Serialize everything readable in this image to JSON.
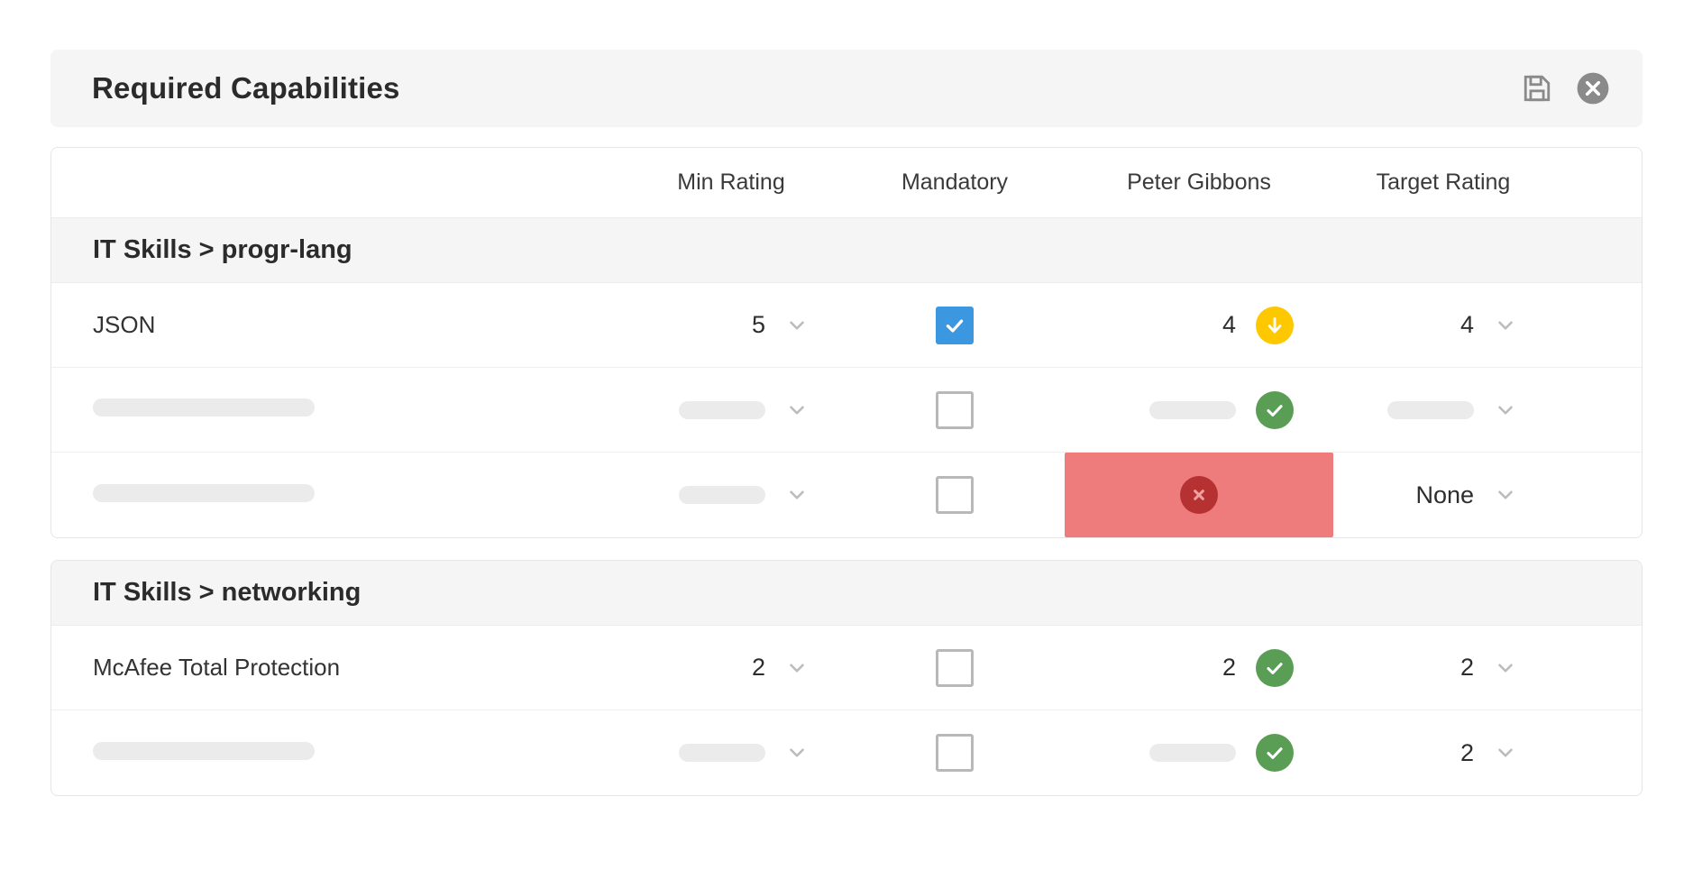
{
  "header": {
    "title": "Required Capabilities",
    "save_icon": "save-floppy-icon",
    "close_icon": "close-circle-icon"
  },
  "columns": {
    "name": "",
    "min_rating": "Min Rating",
    "mandatory": "Mandatory",
    "person": "Peter Gibbons",
    "target_rating": "Target Rating"
  },
  "colors": {
    "checkbox_checked": "#3b97e0",
    "badge_green": "#5a9e56",
    "badge_yellow": "#fdc800",
    "badge_red": "#b63232",
    "alert_cell_bg": "#ef7c7c",
    "group_header_bg": "#f5f5f5",
    "skeleton": "#ebebeb"
  },
  "groups": [
    {
      "label": "IT Skills > progr-lang",
      "rows": [
        {
          "name": "JSON",
          "name_placeholder": false,
          "min_rating": "5",
          "min_placeholder": false,
          "mandatory": true,
          "person_rating": "4",
          "person_placeholder": false,
          "person_status": "yellow",
          "person_status_icon": "arrow-down-icon",
          "person_alert": false,
          "target_rating": "4",
          "target_placeholder": false
        },
        {
          "name": "",
          "name_placeholder": true,
          "min_rating": "",
          "min_placeholder": true,
          "mandatory": false,
          "person_rating": "",
          "person_placeholder": true,
          "person_status": "green",
          "person_status_icon": "check-icon",
          "person_alert": false,
          "target_rating": "",
          "target_placeholder": true
        },
        {
          "name": "",
          "name_placeholder": true,
          "min_rating": "",
          "min_placeholder": true,
          "mandatory": false,
          "person_rating": "",
          "person_placeholder": false,
          "person_status": "red",
          "person_status_icon": "x-icon",
          "person_alert": true,
          "target_rating": "None",
          "target_placeholder": false
        }
      ]
    },
    {
      "label": "IT Skills > networking",
      "rows": [
        {
          "name": "McAfee Total Protection",
          "name_placeholder": false,
          "min_rating": "2",
          "min_placeholder": false,
          "mandatory": false,
          "person_rating": "2",
          "person_placeholder": false,
          "person_status": "green",
          "person_status_icon": "check-icon",
          "person_alert": false,
          "target_rating": "2",
          "target_placeholder": false
        },
        {
          "name": "",
          "name_placeholder": true,
          "min_rating": "",
          "min_placeholder": true,
          "mandatory": false,
          "person_rating": "",
          "person_placeholder": true,
          "person_status": "green",
          "person_status_icon": "check-icon",
          "person_alert": false,
          "target_rating": "2",
          "target_placeholder": false
        }
      ]
    }
  ]
}
